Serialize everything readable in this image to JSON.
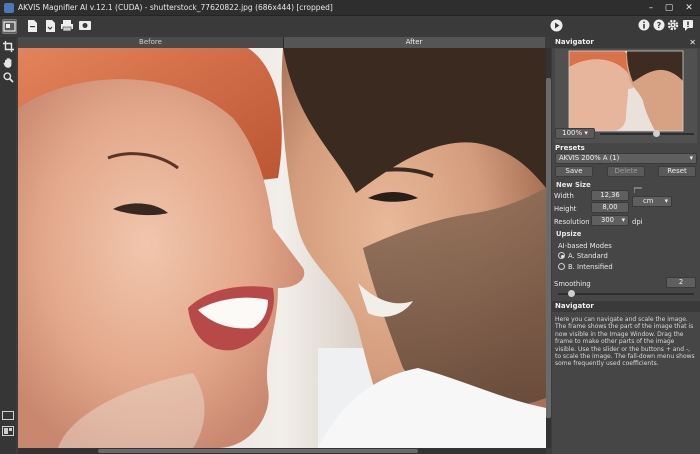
{
  "app": {
    "title": "AKVIS Magnifier AI v.12.1 (CUDA) - shutterstock_77620822.jpg (686x444) [cropped]",
    "window_controls": {
      "minimize": "–",
      "maximize": "▢",
      "close": "✕"
    }
  },
  "toolbar": {
    "icons": [
      "home-icon",
      "open-file-icon",
      "save-file-icon",
      "print-icon",
      "share-icon",
      "run-icon",
      "info-icon",
      "help-icon",
      "settings-icon",
      "notification-icon"
    ]
  },
  "tools": [
    "crop-icon",
    "hand-icon",
    "zoom-icon"
  ],
  "view": {
    "tab_before": "Before",
    "tab_after": "After"
  },
  "navigator": {
    "title": "Navigator",
    "zoom": "100%",
    "zoom_slider_fraction": 0.6
  },
  "presets": {
    "title": "Presets",
    "selected": "AKVIS 200% A (1)",
    "save": "Save",
    "delete": "Delete",
    "reset": "Reset"
  },
  "new_size": {
    "title": "New Size",
    "width_label": "Width",
    "width_value": "12,36",
    "height_label": "Height",
    "height_value": "8,00",
    "unit": "cm",
    "resolution_label": "Resolution",
    "resolution_value": "300",
    "resolution_unit": "dpi"
  },
  "upsize": {
    "title": "Upsize",
    "modes_title": "AI-based Modes",
    "mode_a": "A. Standard",
    "mode_b": "B. Intensified",
    "selected_mode": "A. Standard",
    "smoothing_label": "Smoothing",
    "smoothing_value": "2",
    "smoothing_fraction": 0.1
  },
  "help": {
    "title": "Navigator",
    "text": "Here you can navigate and scale the image. The frame shows the part of the image that is now visible in the Image Window. Drag the frame to make other parts of the image visible. Use the slider or the buttons + and -, to scale the image. The fall-down menu shows some frequently used coefficients."
  }
}
